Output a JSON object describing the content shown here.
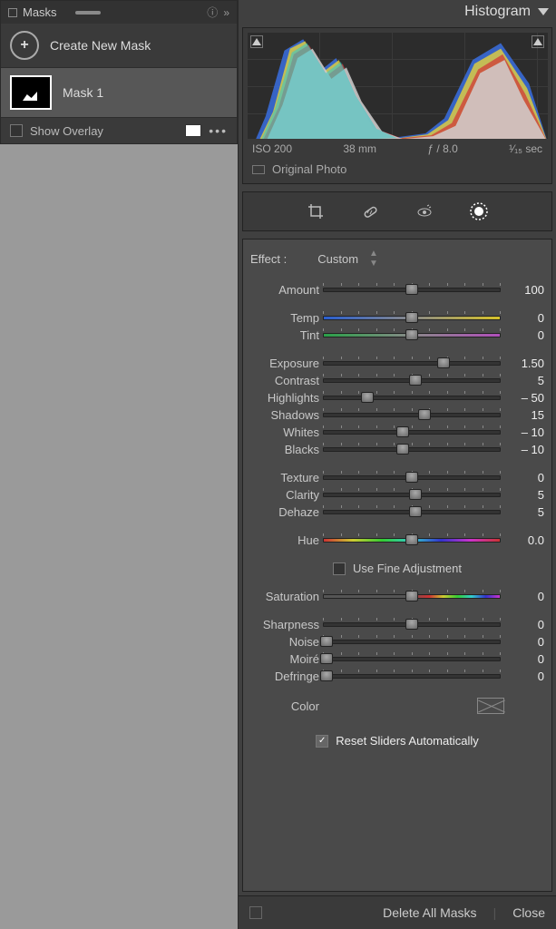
{
  "masks": {
    "title": "Masks",
    "create": "Create New Mask",
    "items": [
      {
        "label": "Mask 1"
      }
    ],
    "show_overlay": "Show Overlay"
  },
  "histogram": {
    "title": "Histogram",
    "iso": "ISO 200",
    "focal": "38 mm",
    "aperture": "ƒ / 8.0",
    "shutter": "¹⁄₁₅ sec",
    "original": "Original Photo"
  },
  "effect": {
    "label": "Effect :",
    "value": "Custom"
  },
  "sliders": {
    "amount": {
      "label": "Amount",
      "value": "100",
      "pos": 50,
      "cls": ""
    },
    "temp": {
      "label": "Temp",
      "value": "0",
      "pos": 50,
      "cls": "temp-bar"
    },
    "tint": {
      "label": "Tint",
      "value": "0",
      "pos": 50,
      "cls": "tint-bar"
    },
    "exposure": {
      "label": "Exposure",
      "value": "1.50",
      "pos": 68,
      "cls": ""
    },
    "contrast": {
      "label": "Contrast",
      "value": "5",
      "pos": 52,
      "cls": ""
    },
    "highlights": {
      "label": "Highlights",
      "value": "– 50",
      "pos": 25,
      "cls": ""
    },
    "shadows": {
      "label": "Shadows",
      "value": "15",
      "pos": 57,
      "cls": ""
    },
    "whites": {
      "label": "Whites",
      "value": "– 10",
      "pos": 45,
      "cls": ""
    },
    "blacks": {
      "label": "Blacks",
      "value": "– 10",
      "pos": 45,
      "cls": ""
    },
    "texture": {
      "label": "Texture",
      "value": "0",
      "pos": 50,
      "cls": ""
    },
    "clarity": {
      "label": "Clarity",
      "value": "5",
      "pos": 52,
      "cls": ""
    },
    "dehaze": {
      "label": "Dehaze",
      "value": "5",
      "pos": 52,
      "cls": ""
    },
    "hue": {
      "label": "Hue",
      "value": "0.0",
      "pos": 50,
      "cls": "hue-bar"
    },
    "saturation": {
      "label": "Saturation",
      "value": "0",
      "pos": 50,
      "cls": "sat-bar"
    },
    "sharpness": {
      "label": "Sharpness",
      "value": "0",
      "pos": 50,
      "cls": ""
    },
    "noise": {
      "label": "Noise",
      "value": "0",
      "pos": 2,
      "cls": ""
    },
    "moire": {
      "label": "Moiré",
      "value": "0",
      "pos": 2,
      "cls": ""
    },
    "defringe": {
      "label": "Defringe",
      "value": "0",
      "pos": 2,
      "cls": ""
    }
  },
  "fine": "Use Fine Adjustment",
  "color_label": "Color",
  "reset": "Reset Sliders Automatically",
  "footer": {
    "delete": "Delete All Masks",
    "close": "Close"
  }
}
